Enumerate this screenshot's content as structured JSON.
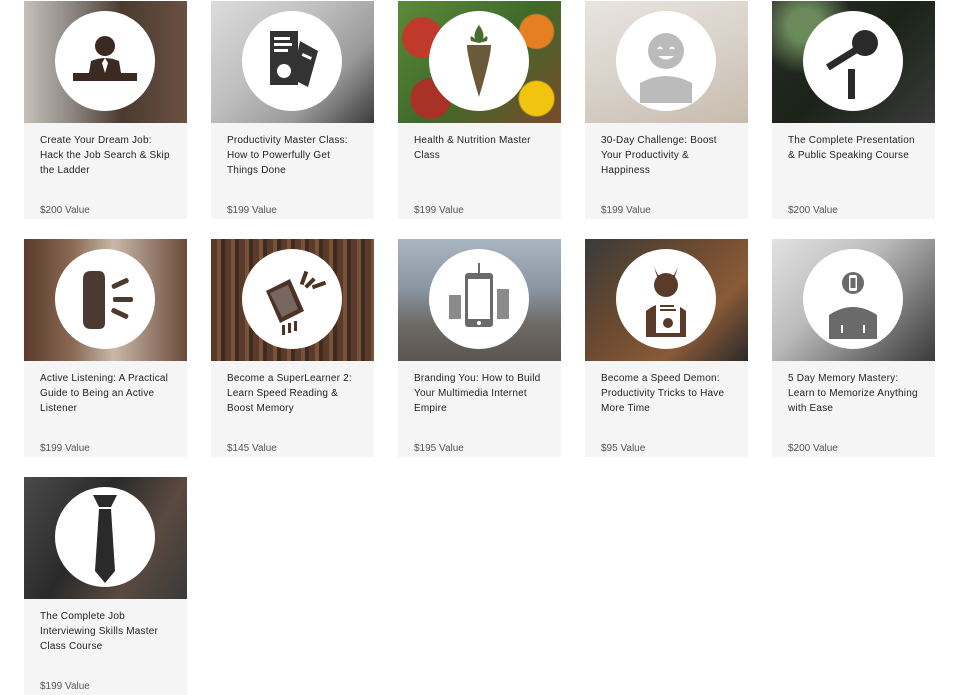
{
  "courses": [
    {
      "title": "Create Your Dream Job: Hack the Job Search & Skip the Ladder",
      "value": "$200 Value",
      "icon": "job-seeker-icon"
    },
    {
      "title": "Productivity Master Class: How to Powerfully Get Things Done",
      "value": "$199 Value",
      "icon": "documents-icon"
    },
    {
      "title": "Health & Nutrition Master Class",
      "value": "$199 Value",
      "icon": "carrot-icon"
    },
    {
      "title": "30-Day Challenge: Boost Your Productivity & Happiness",
      "value": "$199 Value",
      "icon": "smiley-person-icon"
    },
    {
      "title": "The Complete Presentation & Public Speaking Course",
      "value": "$200 Value",
      "icon": "microphone-icon"
    },
    {
      "title": "Active Listening: A Practical Guide to Being an Active Listener",
      "value": "$199 Value",
      "icon": "ear-sound-icon"
    },
    {
      "title": "Become a SuperLearner 2: Learn Speed Reading & Boost Memory",
      "value": "$145 Value",
      "icon": "speed-book-icon"
    },
    {
      "title": "Branding You: How to Build Your Multimedia Internet Empire",
      "value": "$195 Value",
      "icon": "smartphone-icon"
    },
    {
      "title": "Become a Speed Demon: Productivity Tricks to Have More Time",
      "value": "$95 Value",
      "icon": "demon-report-icon"
    },
    {
      "title": "5 Day Memory Mastery: Learn to Memorize Anything with Ease",
      "value": "$200 Value",
      "icon": "memory-person-icon"
    },
    {
      "title": "The Complete Job Interviewing Skills Master Class Course",
      "value": "$199 Value",
      "icon": "necktie-icon"
    }
  ]
}
